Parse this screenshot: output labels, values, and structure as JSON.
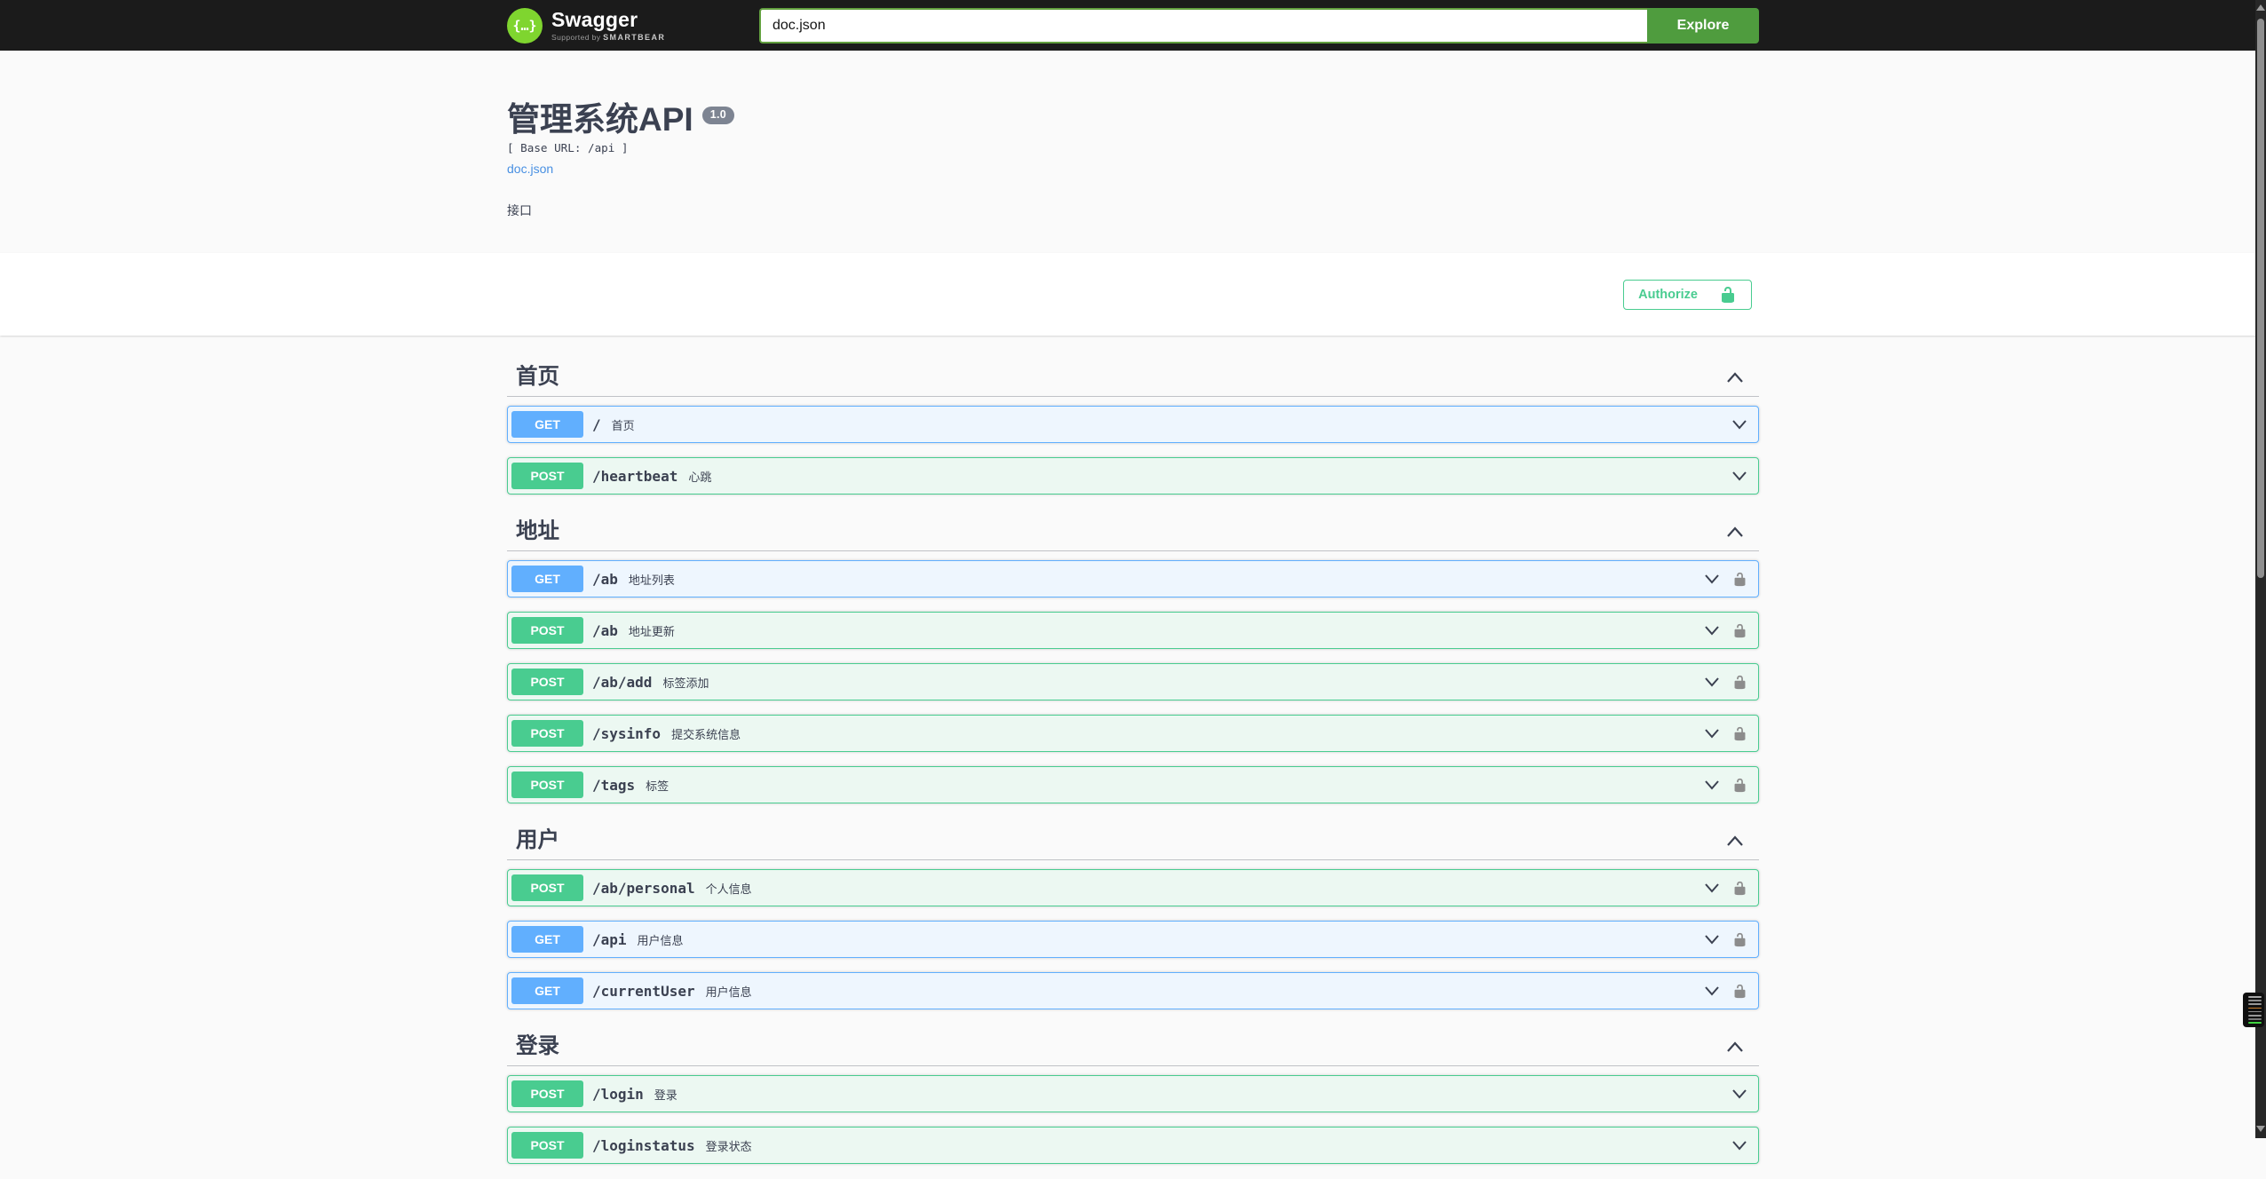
{
  "topbar": {
    "logo_text": "Swagger",
    "logo_glyph": "{…}",
    "tagline_prefix": "Supported by",
    "tagline_brand": "SMARTBEAR",
    "search_value": "doc.json",
    "explore_label": "Explore"
  },
  "info": {
    "title": "管理系统API",
    "version": "1.0",
    "base_url": "[ Base URL: /api ]",
    "doc_link": "doc.json",
    "description": "接口"
  },
  "auth": {
    "authorize_label": "Authorize"
  },
  "sections": [
    {
      "title": "首页",
      "expanded": true,
      "operations": [
        {
          "method": "GET",
          "path": "/",
          "summary": "首页",
          "locked": false
        },
        {
          "method": "POST",
          "path": "/heartbeat",
          "summary": "心跳",
          "locked": false
        }
      ]
    },
    {
      "title": "地址",
      "expanded": true,
      "operations": [
        {
          "method": "GET",
          "path": "/ab",
          "summary": "地址列表",
          "locked": true
        },
        {
          "method": "POST",
          "path": "/ab",
          "summary": "地址更新",
          "locked": true
        },
        {
          "method": "POST",
          "path": "/ab/add",
          "summary": "标签添加",
          "locked": true
        },
        {
          "method": "POST",
          "path": "/sysinfo",
          "summary": "提交系统信息",
          "locked": true
        },
        {
          "method": "POST",
          "path": "/tags",
          "summary": "标签",
          "locked": true
        }
      ]
    },
    {
      "title": "用户",
      "expanded": true,
      "operations": [
        {
          "method": "POST",
          "path": "/ab/personal",
          "summary": "个人信息",
          "locked": true
        },
        {
          "method": "GET",
          "path": "/api",
          "summary": "用户信息",
          "locked": true
        },
        {
          "method": "GET",
          "path": "/currentUser",
          "summary": "用户信息",
          "locked": true
        }
      ]
    },
    {
      "title": "登录",
      "expanded": true,
      "operations": [
        {
          "method": "POST",
          "path": "/login",
          "summary": "登录",
          "locked": false
        },
        {
          "method": "POST",
          "path": "/loginstatus",
          "summary": "登录状态",
          "locked": false
        }
      ]
    }
  ],
  "colors": {
    "topbar_bg": "#1b1b1b",
    "logo_green": "#7fd52f",
    "explore_green": "#4f9c3e",
    "input_border_green": "#62a03f",
    "get_blue": "#61affe",
    "post_green": "#49cc90",
    "authorize_green": "#49cc90",
    "link_blue": "#4990e2",
    "version_badge_gray": "#7d8492",
    "text_dark": "#3b4151"
  },
  "scrollbar": {
    "minimap_lines": [
      "#a8a8a8",
      "#8a8a8a",
      "#979797",
      "#c87d2e",
      "#8a8a8a",
      "#979797",
      "#787878",
      "#3fd23f"
    ]
  }
}
